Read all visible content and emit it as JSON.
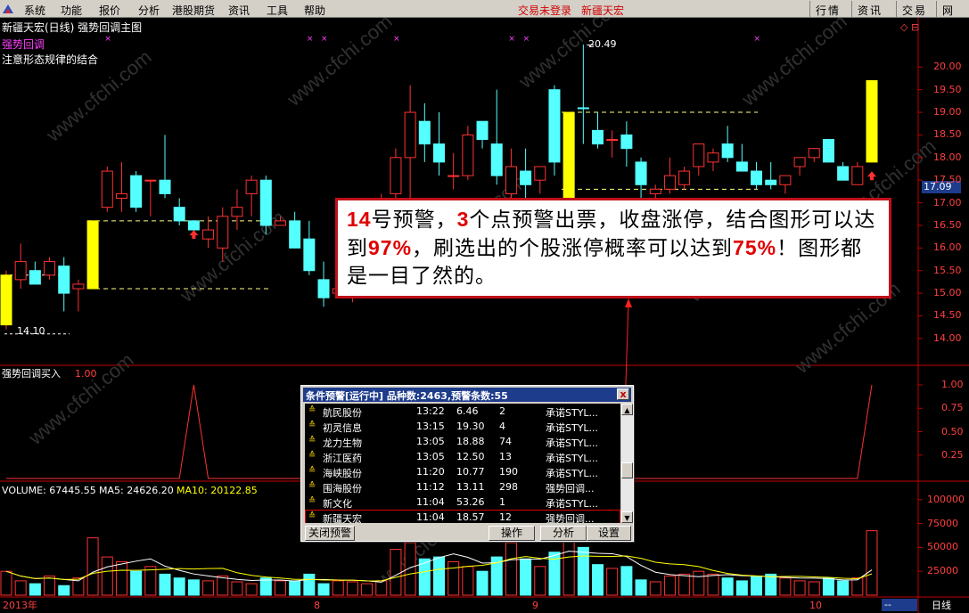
{
  "menubar": {
    "items": [
      "系统",
      "功能",
      "报价",
      "分析",
      "港股期货",
      "资讯",
      "工具",
      "帮助"
    ],
    "status_login": "交易未登录",
    "status_stock": "新疆天宏",
    "right_tabs": [
      "行情",
      "资讯",
      "交易",
      "网上"
    ]
  },
  "chart_header": {
    "title": "新疆天宏(日线) 强势回调主图",
    "formula_name": "强势回调",
    "note": "注意形态规律的结合",
    "high_label": "20.49",
    "low_label": "14.10",
    "current_price_tag": "17.09"
  },
  "price_axis": {
    "labels": [
      "20.00",
      "19.50",
      "19.00",
      "18.50",
      "18.00",
      "17.50",
      "17.00",
      "16.50",
      "16.00",
      "15.50",
      "15.00",
      "14.50",
      "14.00"
    ],
    "color": "#ff4040"
  },
  "indicator_panel": {
    "label": "强势回调买入",
    "value": "1.00",
    "axis_labels": [
      "1.00",
      "0.75",
      "0.50",
      "0.25"
    ]
  },
  "volume_panel": {
    "volume_label": "VOLUME: 67445.55",
    "ma5_label": "MA5: 24626.20",
    "ma10_label": "MA10: 20122.85",
    "axis_labels": [
      "100000",
      "75000",
      "50000",
      "25000"
    ]
  },
  "date_axis": {
    "labels": [
      "2013年",
      "8",
      "9",
      "10"
    ],
    "period": "日线",
    "nav": "--"
  },
  "annotation": {
    "segments": [
      {
        "t": "14",
        "hl": true
      },
      {
        "t": "号预警，",
        "hl": false
      },
      {
        "t": "3",
        "hl": true
      },
      {
        "t": "个点预警出票，收盘涨停，结合图形可以达到",
        "hl": false
      },
      {
        "t": "97%",
        "hl": true
      },
      {
        "t": "，刷选出的个股涨停概率可以达到",
        "hl": false
      },
      {
        "t": "75%",
        "hl": true
      },
      {
        "t": "！图形都是一目了然的。",
        "hl": false
      }
    ]
  },
  "alert_window": {
    "title": "条件预警[运行中] 品种数:2463,预警条数:55",
    "close_label": "x",
    "rows": [
      {
        "name": "航民股份",
        "time": "13:22",
        "price": "6.46",
        "count": "2",
        "strategy": "承诺STYL..."
      },
      {
        "name": "初灵信息",
        "time": "13:15",
        "price": "19.30",
        "count": "4",
        "strategy": "承诺STYL..."
      },
      {
        "name": "龙力生物",
        "time": "13:05",
        "price": "18.88",
        "count": "74",
        "strategy": "承诺STYL..."
      },
      {
        "name": "浙江医药",
        "time": "13:05",
        "price": "12.50",
        "count": "13",
        "strategy": "承诺STYL..."
      },
      {
        "name": "海峡股份",
        "time": "11:20",
        "price": "10.77",
        "count": "190",
        "strategy": "承诺STYL..."
      },
      {
        "name": "围海股份",
        "time": "11:12",
        "price": "13.11",
        "count": "298",
        "strategy": "强势回调..."
      },
      {
        "name": "新文化",
        "time": "11:04",
        "price": "53.26",
        "count": "1",
        "strategy": "承诺STYL..."
      },
      {
        "name": "新疆天宏",
        "time": "11:04",
        "price": "18.57",
        "count": "12",
        "strategy": "强势回调..."
      }
    ],
    "buttons": {
      "close_alert": "关闭预警",
      "operate": "操作",
      "analyze": "分析",
      "settings": "设置"
    }
  },
  "watermark": "www.cfchi.com",
  "colors": {
    "up": "#ff3232",
    "down": "#54ffff",
    "limit": "#ffff00",
    "ma5": "#ffffff",
    "ma10": "#ffff00",
    "dashed": "#ffff80"
  },
  "chart_data": {
    "type": "candlestick",
    "y_range": [
      13.8,
      20.4
    ],
    "candles": [
      {
        "o": 14.3,
        "h": 15.5,
        "l": 14.2,
        "c": 15.4,
        "t": "limit"
      },
      {
        "o": 15.3,
        "h": 16.1,
        "l": 15.1,
        "c": 15.7,
        "t": "up"
      },
      {
        "o": 15.5,
        "h": 15.7,
        "l": 15.3,
        "c": 15.2,
        "t": "down"
      },
      {
        "o": 15.4,
        "h": 15.8,
        "l": 15.3,
        "c": 15.7,
        "t": "up"
      },
      {
        "o": 15.6,
        "h": 15.8,
        "l": 14.6,
        "c": 15.0,
        "t": "down"
      },
      {
        "o": 15.1,
        "h": 15.3,
        "l": 14.6,
        "c": 15.2,
        "t": "up"
      },
      {
        "o": 15.1,
        "h": 16.6,
        "l": 15.1,
        "c": 16.6,
        "t": "limit"
      },
      {
        "o": 16.9,
        "h": 17.8,
        "l": 16.8,
        "c": 17.7,
        "t": "up"
      },
      {
        "o": 17.1,
        "h": 17.9,
        "l": 16.8,
        "c": 17.2,
        "t": "up"
      },
      {
        "o": 17.6,
        "h": 17.7,
        "l": 16.8,
        "c": 16.9,
        "t": "down"
      },
      {
        "o": 17.5,
        "h": 17.5,
        "l": 16.7,
        "c": 17.5,
        "t": "up"
      },
      {
        "o": 17.5,
        "h": 18.5,
        "l": 17.1,
        "c": 17.2,
        "t": "down"
      },
      {
        "o": 16.9,
        "h": 17.1,
        "l": 16.5,
        "c": 16.6,
        "t": "down"
      },
      {
        "o": 16.6,
        "h": 16.6,
        "l": 16.3,
        "c": 16.4,
        "t": "down"
      },
      {
        "o": 16.4,
        "h": 16.7,
        "l": 16.0,
        "c": 16.2,
        "t": "up"
      },
      {
        "o": 16.0,
        "h": 16.9,
        "l": 15.7,
        "c": 16.7,
        "t": "up"
      },
      {
        "o": 16.7,
        "h": 17.3,
        "l": 16.4,
        "c": 16.9,
        "t": "up"
      },
      {
        "o": 17.2,
        "h": 17.6,
        "l": 16.7,
        "c": 17.5,
        "t": "up"
      },
      {
        "o": 17.5,
        "h": 17.6,
        "l": 16.3,
        "c": 16.5,
        "t": "down"
      },
      {
        "o": 16.6,
        "h": 16.7,
        "l": 16.5,
        "c": 16.5,
        "t": "up"
      },
      {
        "o": 16.6,
        "h": 16.8,
        "l": 16.0,
        "c": 16.0,
        "t": "down"
      },
      {
        "o": 16.2,
        "h": 16.6,
        "l": 15.4,
        "c": 15.5,
        "t": "down"
      },
      {
        "o": 15.3,
        "h": 15.7,
        "l": 14.7,
        "c": 14.9,
        "t": "down"
      },
      {
        "o": 15.0,
        "h": 15.2,
        "l": 14.9,
        "c": 15.1,
        "t": "up"
      },
      {
        "o": 14.9,
        "h": 15.4,
        "l": 14.8,
        "c": 15.3,
        "t": "up"
      },
      {
        "o": 15.3,
        "h": 15.7,
        "l": 15.3,
        "c": 15.5,
        "t": "up"
      },
      {
        "o": 17.1,
        "h": 17.2,
        "l": 17.0,
        "c": 17.1,
        "t": "up"
      },
      {
        "o": 17.2,
        "h": 18.2,
        "l": 16.8,
        "c": 18.0,
        "t": "up"
      },
      {
        "o": 18.0,
        "h": 19.6,
        "l": 16.9,
        "c": 19.0,
        "t": "up"
      },
      {
        "o": 18.8,
        "h": 19.2,
        "l": 17.9,
        "c": 18.3,
        "t": "down"
      },
      {
        "o": 18.3,
        "h": 19.0,
        "l": 17.6,
        "c": 17.9,
        "t": "down"
      },
      {
        "o": 17.6,
        "h": 18.1,
        "l": 17.3,
        "c": 17.6,
        "t": "up"
      },
      {
        "o": 17.6,
        "h": 18.7,
        "l": 17.5,
        "c": 18.5,
        "t": "up"
      },
      {
        "o": 18.8,
        "h": 18.8,
        "l": 18.2,
        "c": 18.4,
        "t": "down"
      },
      {
        "o": 18.3,
        "h": 19.5,
        "l": 17.4,
        "c": 17.6,
        "t": "down"
      },
      {
        "o": 17.2,
        "h": 18.2,
        "l": 16.9,
        "c": 17.8,
        "t": "up"
      },
      {
        "o": 17.7,
        "h": 18.2,
        "l": 16.9,
        "c": 17.4,
        "t": "down"
      },
      {
        "o": 17.5,
        "h": 17.8,
        "l": 17.2,
        "c": 17.8,
        "t": "up"
      },
      {
        "o": 19.5,
        "h": 19.6,
        "l": 17.6,
        "c": 17.9,
        "t": "down"
      },
      {
        "o": 17.0,
        "h": 19.0,
        "l": 16.8,
        "c": 19.0,
        "t": "limit"
      },
      {
        "o": 19.1,
        "h": 20.5,
        "l": 18.3,
        "c": 19.1,
        "t": "down"
      },
      {
        "o": 18.6,
        "h": 19.0,
        "l": 18.2,
        "c": 18.3,
        "t": "down"
      },
      {
        "o": 18.4,
        "h": 18.6,
        "l": 18.0,
        "c": 18.4,
        "t": "up"
      },
      {
        "o": 18.5,
        "h": 18.8,
        "l": 17.8,
        "c": 18.2,
        "t": "down"
      },
      {
        "o": 17.9,
        "h": 18.0,
        "l": 17.1,
        "c": 17.4,
        "t": "down"
      },
      {
        "o": 17.2,
        "h": 17.4,
        "l": 17.1,
        "c": 17.3,
        "t": "up"
      },
      {
        "o": 17.3,
        "h": 18.0,
        "l": 17.2,
        "c": 17.6,
        "t": "up"
      },
      {
        "o": 17.4,
        "h": 17.8,
        "l": 17.3,
        "c": 17.7,
        "t": "up"
      },
      {
        "o": 17.8,
        "h": 18.1,
        "l": 17.6,
        "c": 18.3,
        "t": "up"
      },
      {
        "o": 17.9,
        "h": 18.2,
        "l": 17.7,
        "c": 18.1,
        "t": "up"
      },
      {
        "o": 18.3,
        "h": 18.7,
        "l": 17.9,
        "c": 18.0,
        "t": "down"
      },
      {
        "o": 17.9,
        "h": 18.3,
        "l": 17.7,
        "c": 17.7,
        "t": "down"
      },
      {
        "o": 17.7,
        "h": 17.9,
        "l": 17.3,
        "c": 17.4,
        "t": "down"
      },
      {
        "o": 17.5,
        "h": 17.9,
        "l": 17.3,
        "c": 17.4,
        "t": "down"
      },
      {
        "o": 17.4,
        "h": 17.5,
        "l": 17.2,
        "c": 17.6,
        "t": "up"
      },
      {
        "o": 17.8,
        "h": 18.0,
        "l": 17.6,
        "c": 18.0,
        "t": "up"
      },
      {
        "o": 18.0,
        "h": 18.2,
        "l": 17.9,
        "c": 18.2,
        "t": "up"
      },
      {
        "o": 18.4,
        "h": 18.4,
        "l": 17.9,
        "c": 17.9,
        "t": "down"
      },
      {
        "o": 17.8,
        "h": 17.9,
        "l": 17.5,
        "c": 17.5,
        "t": "down"
      },
      {
        "o": 17.4,
        "h": 17.9,
        "l": 17.4,
        "c": 17.8,
        "t": "up"
      },
      {
        "o": 17.9,
        "h": 19.7,
        "l": 17.9,
        "c": 19.7,
        "t": "limit"
      }
    ],
    "buy_signal": [
      0,
      0,
      0,
      0,
      0,
      0,
      0,
      0,
      0,
      0,
      0,
      0,
      0,
      1,
      0,
      0,
      0,
      0,
      0,
      0,
      0,
      0,
      0,
      0,
      0,
      0,
      0,
      0,
      0,
      0,
      0,
      0,
      0,
      0,
      0,
      0,
      0,
      0,
      0,
      0,
      0,
      0,
      0,
      0,
      0,
      0,
      0,
      0,
      0,
      0,
      0,
      0,
      0,
      0,
      0,
      0,
      0,
      0,
      0,
      0,
      1
    ],
    "volumes": [
      25000,
      15000,
      12000,
      20000,
      10000,
      18000,
      60000,
      40000,
      35000,
      25000,
      30000,
      22000,
      18000,
      16000,
      15000,
      20000,
      14000,
      12000,
      18000,
      15000,
      15000,
      22000,
      12000,
      15000,
      14000,
      12000,
      15000,
      48000,
      55000,
      38000,
      40000,
      35000,
      30000,
      25000,
      40000,
      55000,
      38000,
      30000,
      45000,
      62000,
      50000,
      32000,
      28000,
      30000,
      16000,
      14000,
      20000,
      22000,
      25000,
      22000,
      18000,
      15000,
      20000,
      22000,
      18000,
      15000,
      14000,
      18000,
      15000,
      18000,
      67445
    ]
  }
}
